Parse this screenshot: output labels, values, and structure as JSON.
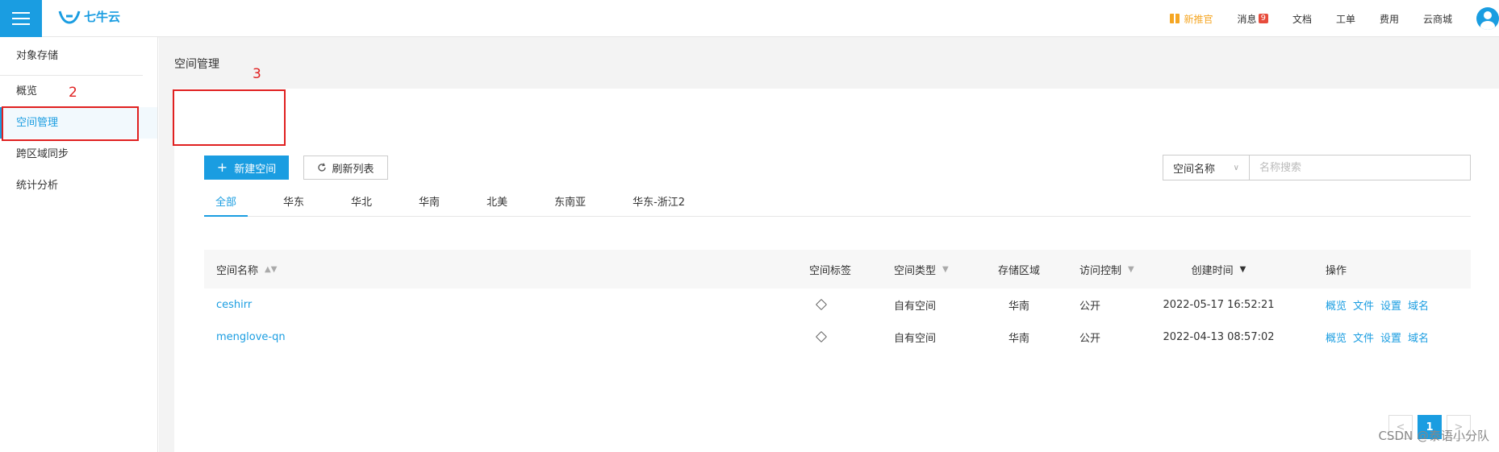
{
  "topbar": {
    "logo_text": "七牛云",
    "promo": "新推官",
    "messages": "消息",
    "messages_badge": "9",
    "docs": "文档",
    "tickets": "工单",
    "billing": "费用",
    "mall": "云商城"
  },
  "sidebar": {
    "items": [
      {
        "label": "对象存储"
      },
      {
        "label": "概览"
      },
      {
        "label": "空间管理"
      },
      {
        "label": "跨区域同步"
      },
      {
        "label": "统计分析"
      }
    ]
  },
  "main": {
    "title": "空间管理",
    "create_button": "新建空间",
    "refresh_button": "刷新列表",
    "search_select": "空间名称",
    "search_placeholder": "名称搜索",
    "tabs": [
      "全部",
      "华东",
      "华北",
      "华南",
      "北美",
      "东南亚",
      "华东-浙江2"
    ]
  },
  "table": {
    "headers": [
      "空间名称",
      "空间标签",
      "空间类型",
      "存储区域",
      "访问控制",
      "创建时间",
      "操作"
    ],
    "rows": [
      {
        "name": "ceshirr",
        "type": "自有空间",
        "region": "华南",
        "access": "公开",
        "created": "2022-05-17 16:52:21"
      },
      {
        "name": "menglove-qn",
        "type": "自有空间",
        "region": "华南",
        "access": "公开",
        "created": "2022-04-13 08:57:02"
      }
    ],
    "actions": [
      "概览",
      "文件",
      "设置",
      "域名"
    ]
  },
  "pagination": {
    "current": "1",
    "prev": "<",
    "next": ">"
  },
  "annotations": {
    "label_2": "2",
    "label_3": "3"
  },
  "watermark": "CSDN @泰语小分队",
  "colors": {
    "accent": "#1a9de1",
    "annotation_red": "#e02020",
    "promo_orange": "#f5a623"
  }
}
